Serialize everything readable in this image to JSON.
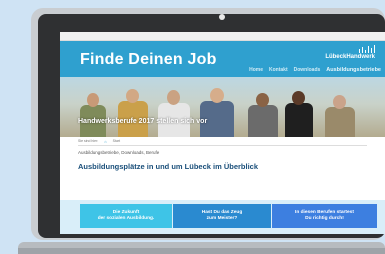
{
  "site": {
    "title": "Finde Deinen Job",
    "logo_text": "LübeckHandwerk",
    "nav": [
      "Home",
      "Kontakt",
      "Downloads",
      "Ausbildungsbetriebe"
    ]
  },
  "hero": {
    "caption": "Handwerksberufe 2017 stellen sich vor"
  },
  "breadcrumb": {
    "items": [
      "Sie sind hier:",
      "Start"
    ]
  },
  "tags": "Ausbildungsbetriebe, Downloads, Berufe",
  "headline": "Ausbildungsplätze in und um Lübeck im Überblick",
  "buttons": [
    {
      "line1": "Die Zukunft",
      "line2": "der sozialen Ausbildung."
    },
    {
      "line1": "Hast Du das Zeug",
      "line2": "zum Meister?"
    },
    {
      "line1": "In diesen Berufen startest",
      "line2": "Du richtig durch!"
    }
  ],
  "colors": {
    "header": "#2fa0cf",
    "button1": "#3ec4e7",
    "button2": "#2a8ad0",
    "button3": "#3d7fe0",
    "background": "#cfe3f4"
  }
}
